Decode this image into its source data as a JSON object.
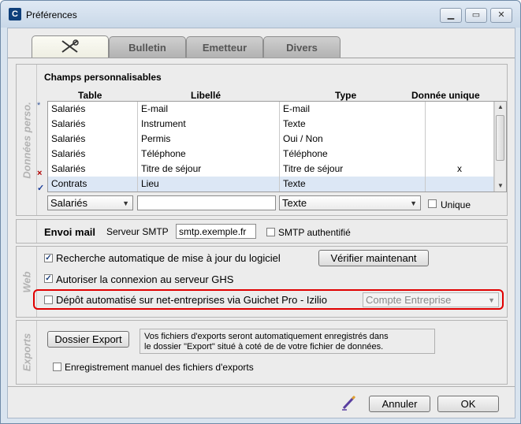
{
  "window": {
    "title": "Préférences",
    "app_icon": "C"
  },
  "tabs": [
    {
      "label": "",
      "icon": "tools-icon"
    },
    {
      "label": "Bulletin"
    },
    {
      "label": "Emetteur"
    },
    {
      "label": "Divers"
    }
  ],
  "perso": {
    "side_label": "Données perso.",
    "section_title": "Champs personnalisables",
    "columns": [
      "Table",
      "Libellé",
      "Type",
      "Donnée unique"
    ],
    "rows": [
      {
        "marker": "*",
        "table": "Salariés",
        "libelle": "E-mail",
        "type": "E-mail",
        "unique": ""
      },
      {
        "marker": "",
        "table": "Salariés",
        "libelle": "Instrument",
        "type": "Texte",
        "unique": ""
      },
      {
        "marker": "",
        "table": "Salariés",
        "libelle": "Permis",
        "type": "Oui / Non",
        "unique": ""
      },
      {
        "marker": "",
        "table": "Salariés",
        "libelle": "Téléphone",
        "type": "Téléphone",
        "unique": ""
      },
      {
        "marker": "×",
        "table": "Salariés",
        "libelle": "Titre de séjour",
        "type": "Titre de séjour",
        "unique": "x"
      },
      {
        "marker": "✓",
        "table": "Contrats",
        "libelle": "Lieu",
        "type": "Texte",
        "unique": ""
      }
    ],
    "edit_table": "Salariés",
    "edit_libelle": "",
    "edit_type": "Texte",
    "unique_label": "Unique"
  },
  "mail": {
    "title": "Envoi mail",
    "smtp_label": "Serveur SMTP",
    "smtp_value": "smtp.exemple.fr",
    "auth_label": "SMTP authentifié"
  },
  "web": {
    "side_label": "Web",
    "auto_update_label": "Recherche automatique de mise à jour du logiciel",
    "verify_button": "Vérifier maintenant",
    "ghs_label": "Autoriser la connexion au serveur GHS",
    "depot_label": "Dépôt automatisé sur net-entreprises via Guichet Pro - Izilio",
    "account_select": "Compte Entreprise"
  },
  "exports": {
    "side_label": "Exports",
    "folder_button": "Dossier Export",
    "info_line1": "Vos fichiers d'exports seront automatiquement enregistrés dans",
    "info_line2": "le dossier \"Export\" situé à coté de de votre fichier de données.",
    "manual_label": "Enregistrement manuel des fichiers d'exports"
  },
  "footer": {
    "cancel": "Annuler",
    "ok": "OK"
  }
}
